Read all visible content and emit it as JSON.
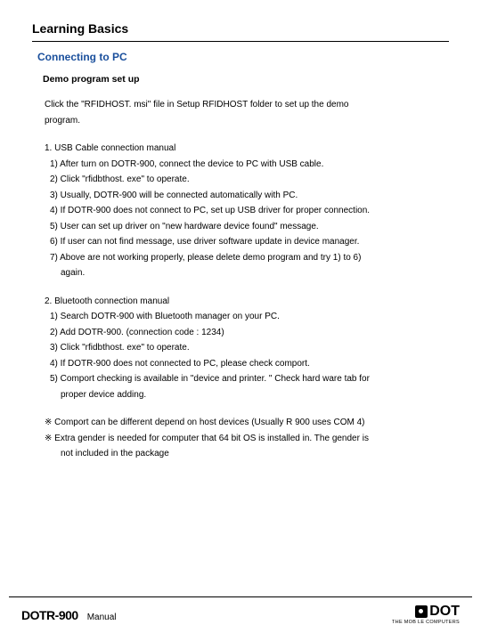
{
  "title": "Learning Basics",
  "subtitle": "Connecting to PC",
  "section_head": "Demo program set up",
  "intro_l1": "Click the \"RFIDHOST. msi\" file in Setup RFIDHOST folder to set up the demo",
  "intro_l2": "program.",
  "usb": {
    "heading": "1. USB Cable connection manual",
    "items": [
      "1) After turn on DOTR-900, connect the device to PC with USB cable.",
      "2) Click \"rfidbthost. exe\" to operate.",
      "3) Usually, DOTR-900 will be connected automatically with PC.",
      "4) If DOTR-900 does not connect to PC, set up USB driver for proper connection.",
      "5) User can set up driver on \"new hardware device found\" message.",
      "6) If user can not find message, use driver software update in device manager.",
      "7) Above are not working properly, please delete demo program and try 1) to 6)"
    ],
    "tail": "again."
  },
  "bt": {
    "heading": "2. Bluetooth connection manual",
    "items": [
      "1) Search DOTR-900 with Bluetooth manager on your PC.",
      "2) Add DOTR-900. (connection code : 1234)",
      "3) Click \"rfidbthost. exe\" to operate.",
      "4) If DOTR-900 does not connected to PC, please check comport.",
      "5) Comport checking is available in \"device and printer. \" Check hard ware tab for"
    ],
    "tail": "proper device adding."
  },
  "notes": {
    "n1": "※ Comport can be different depend on host devices (Usually R 900 uses COM 4)",
    "n2a": "※ Extra gender is needed for computer that 64 bit OS is installed in. The gender is",
    "n2b": "not included in the package"
  },
  "footer": {
    "model": "DOTR-900",
    "manual": "Manual",
    "brand": "DOT",
    "brand_sub": "THE MOB LE COMPUTERS"
  }
}
